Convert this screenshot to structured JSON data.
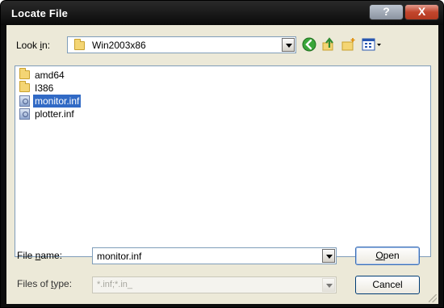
{
  "window": {
    "title": "Locate File",
    "help_glyph": "?",
    "close_glyph": "X"
  },
  "look_in": {
    "label_pre": "Look ",
    "label_u": "i",
    "label_post": "n:",
    "value": "Win2003x86",
    "icon": "folder-icon"
  },
  "toolbar": {
    "icons": [
      "back-icon",
      "up-one-level-icon",
      "create-new-folder-icon",
      "view-menu-icon"
    ]
  },
  "files": [
    {
      "name": "amd64",
      "type": "folder",
      "selected": false
    },
    {
      "name": "I386",
      "type": "folder",
      "selected": false
    },
    {
      "name": "monitor.inf",
      "type": "inf",
      "selected": true
    },
    {
      "name": "plotter.inf",
      "type": "inf",
      "selected": false
    }
  ],
  "file_name": {
    "label_pre": "File ",
    "label_u": "n",
    "label_post": "ame:",
    "value": "monitor.inf"
  },
  "file_type": {
    "label_pre": "Files of ",
    "label_u": "t",
    "label_post": "ype:",
    "value": "*.inf;*.in_"
  },
  "buttons": {
    "open_u": "O",
    "open_rest": "pen",
    "cancel": "Cancel"
  },
  "colors": {
    "selection": "#316ac5",
    "dialog_bg": "#ece9d8",
    "title_bar": "#0d0d0d"
  }
}
